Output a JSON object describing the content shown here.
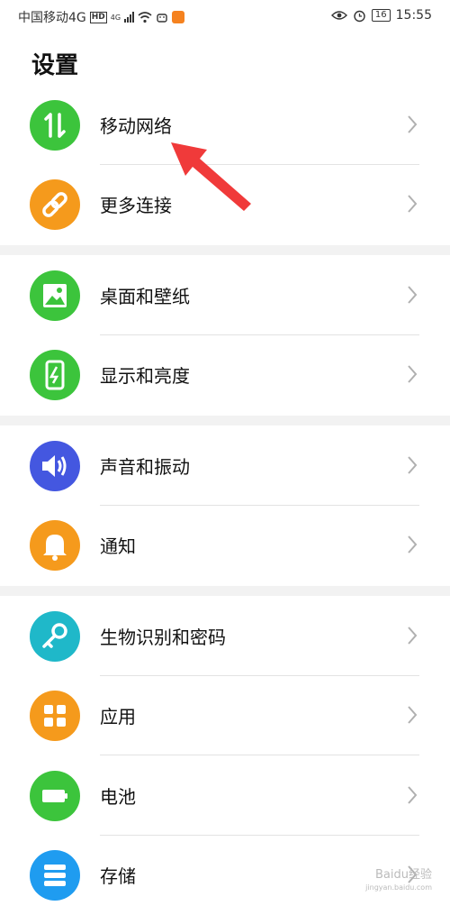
{
  "status_bar": {
    "carrier": "中国移动4G",
    "hd": "HD",
    "network": "4G",
    "battery": "16",
    "time": "15:55"
  },
  "page_title": "设置",
  "items": [
    {
      "label": "移动网络",
      "icon": "swap-vertical-icon",
      "color": "#3cc43c"
    },
    {
      "label": "更多连接",
      "icon": "link-icon",
      "color": "#f59a1c"
    },
    {
      "label": "桌面和壁纸",
      "icon": "image-icon",
      "color": "#3cc43c"
    },
    {
      "label": "显示和亮度",
      "icon": "phone-brightness-icon",
      "color": "#3cc43c"
    },
    {
      "label": "声音和振动",
      "icon": "speaker-icon",
      "color": "#4457e0"
    },
    {
      "label": "通知",
      "icon": "bell-icon",
      "color": "#f59a1c"
    },
    {
      "label": "生物识别和密码",
      "icon": "key-icon",
      "color": "#1fb8c9"
    },
    {
      "label": "应用",
      "icon": "apps-grid-icon",
      "color": "#f59a1c"
    },
    {
      "label": "电池",
      "icon": "battery-icon",
      "color": "#3cc43c"
    },
    {
      "label": "存储",
      "icon": "storage-icon",
      "color": "#1f9cf0"
    }
  ],
  "annotation_color": "#f03a3a",
  "watermark": {
    "text": "Baidu经验",
    "sub": "jingyan.baidu.com"
  }
}
